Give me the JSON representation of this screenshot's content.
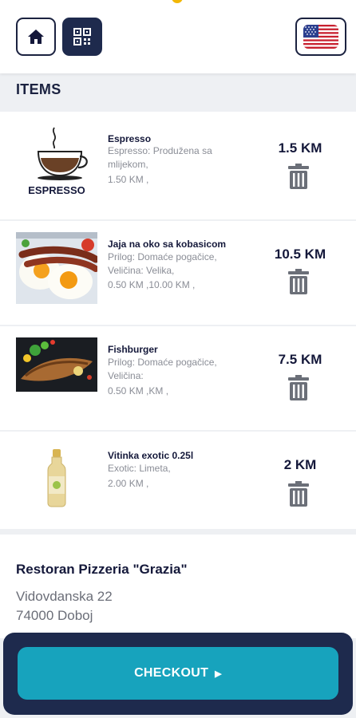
{
  "header": {
    "home_icon": "home-icon",
    "qr_icon": "qr-code-icon",
    "flag_icon": "us-flag-icon"
  },
  "items_title": "ITEMS",
  "items": [
    {
      "name": "Espresso",
      "desc": "Espresso: Produžena sa mlijekom,",
      "prices": "1.50 KM ,",
      "total": "1.5 KM",
      "image_label": "ESPRESSO"
    },
    {
      "name": "Jaja na oko sa kobasicom",
      "desc": "Prilog: Domaće pogačice, Veličina: Velika,",
      "prices": "0.50 KM ,10.00 KM ,",
      "total": "10.5 KM"
    },
    {
      "name": "Fishburger",
      "desc": "Prilog: Domaće pogačice, Veličina:",
      "prices": "0.50 KM ,KM ,",
      "total": "7.5 KM"
    },
    {
      "name": "Vitinka exotic 0.25l",
      "desc": "Exotic: Limeta,",
      "prices": "2.00 KM ,",
      "total": "2 KM"
    }
  ],
  "restaurant": {
    "name": "Restoran Pizzeria \"Grazia\"",
    "street": "Vidovdanska 22",
    "city": "74000 Doboj"
  },
  "checkout_label": "CHECKOUT",
  "colors": {
    "navy": "#1e2a4d",
    "teal": "#17a3bd",
    "accent_yellow": "#f2b705"
  }
}
